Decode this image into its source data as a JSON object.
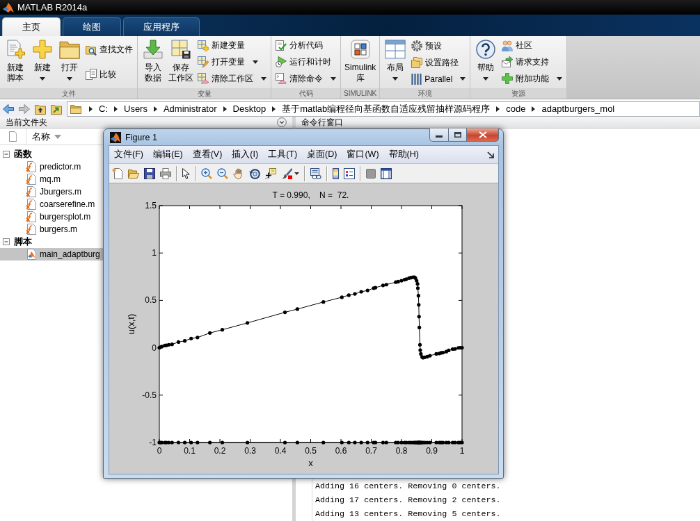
{
  "window": {
    "title": "MATLAB R2014a"
  },
  "toolstrip": {
    "tabs": [
      {
        "label": "主页",
        "selected": true
      },
      {
        "label": "绘图",
        "selected": false
      },
      {
        "label": "应用程序",
        "selected": false
      }
    ],
    "sections": [
      {
        "label": "文件",
        "items": [
          {
            "kind": "large",
            "label": "新建脚本",
            "dropdown": false
          },
          {
            "kind": "large",
            "label": "新建",
            "dropdown": true
          },
          {
            "kind": "large",
            "label": "打开",
            "dropdown": true
          },
          {
            "kind": "small",
            "label": "查找文件",
            "dropdown": false
          },
          {
            "kind": "small",
            "label": "比较",
            "dropdown": false
          }
        ]
      },
      {
        "label": "变量",
        "items": [
          {
            "kind": "large",
            "label": "导入数据",
            "dropdown": false
          },
          {
            "kind": "large",
            "label": "保存工作区",
            "dropdown": false
          },
          {
            "kind": "small",
            "label": "新建变量",
            "dropdown": false
          },
          {
            "kind": "small",
            "label": "打开变量",
            "dropdown": true
          },
          {
            "kind": "small",
            "label": "清除工作区",
            "dropdown": true
          }
        ]
      },
      {
        "label": "代码",
        "items": [
          {
            "kind": "small",
            "label": "分析代码",
            "dropdown": false
          },
          {
            "kind": "small",
            "label": "运行和计时",
            "dropdown": false
          },
          {
            "kind": "small",
            "label": "清除命令",
            "dropdown": true
          }
        ]
      },
      {
        "label": "SIMULINK",
        "items": [
          {
            "kind": "large",
            "label": "Simulink 库",
            "dropdown": false
          }
        ]
      },
      {
        "label": "环境",
        "items": [
          {
            "kind": "large",
            "label": "布局",
            "dropdown": true
          },
          {
            "kind": "small",
            "label": "预设",
            "dropdown": false
          },
          {
            "kind": "small",
            "label": "设置路径",
            "dropdown": false
          },
          {
            "kind": "small",
            "label": "Parallel",
            "dropdown": true
          }
        ]
      },
      {
        "label": "资源",
        "items": [
          {
            "kind": "large",
            "label": "帮助",
            "dropdown": true
          },
          {
            "kind": "small",
            "label": "社区",
            "dropdown": false
          },
          {
            "kind": "small",
            "label": "请求支持",
            "dropdown": false
          },
          {
            "kind": "small",
            "label": "附加功能",
            "dropdown": true
          }
        ]
      }
    ]
  },
  "address_bar": {
    "path": [
      "C:",
      "Users",
      "Administrator",
      "Desktop",
      "基于matlab编程径向基函数自适应残留抽样源码程序",
      "code",
      "adaptburgers_mol"
    ]
  },
  "current_folder": {
    "title": "当前文件夹",
    "column": "名称",
    "groups": [
      {
        "label": "函数",
        "expanded": true,
        "children": [
          {
            "name": "predictor.m",
            "kind": "function",
            "selected": false
          },
          {
            "name": "mq.m",
            "kind": "function",
            "selected": false
          },
          {
            "name": "Jburgers.m",
            "kind": "function",
            "selected": false
          },
          {
            "name": "coarserefine.m",
            "kind": "function",
            "selected": false
          },
          {
            "name": "burgersplot.m",
            "kind": "function",
            "selected": false
          },
          {
            "name": "burgers.m",
            "kind": "function",
            "selected": false
          }
        ]
      },
      {
        "label": "脚本",
        "expanded": true,
        "children": [
          {
            "name": "main_adaptburg",
            "kind": "script",
            "selected": true
          }
        ]
      }
    ]
  },
  "command_window": {
    "title": "命令行窗口",
    "lines": [
      "Adding 16 centers. Removing 0 centers.",
      "Adding 17 centers. Removing 2 centers.",
      "Adding 13 centers. Removing 5 centers."
    ]
  },
  "figure": {
    "title": "Figure 1",
    "menu": [
      "文件(F)",
      "编辑(E)",
      "查看(V)",
      "插入(I)",
      "工具(T)",
      "桌面(D)",
      "窗口(W)",
      "帮助(H)"
    ],
    "chart_data": {
      "type": "line",
      "title": "T = 0.990,    N =  72.",
      "xlabel": "x",
      "ylabel": "u(x,t)",
      "xlim": [
        0,
        1
      ],
      "ylim": [
        -1,
        1.5
      ],
      "xticks": [
        0,
        0.1,
        0.2,
        0.3,
        0.4,
        0.5,
        0.6,
        0.7,
        0.8,
        0.9,
        1
      ],
      "yticks": [
        -1,
        -0.5,
        0,
        0.5,
        1,
        1.5
      ],
      "x": [
        0,
        0.003,
        0.008,
        0.018,
        0.023,
        0.031,
        0.042,
        0.063,
        0.084,
        0.105,
        0.126,
        0.167,
        0.208,
        0.291,
        0.415,
        0.456,
        0.542,
        0.603,
        0.626,
        0.646,
        0.667,
        0.688,
        0.708,
        0.714,
        0.739,
        0.75,
        0.781,
        0.789,
        0.8,
        0.81,
        0.816,
        0.825,
        0.831,
        0.838,
        0.843,
        0.846,
        0.85,
        0.853,
        0.854,
        0.856,
        0.857,
        0.858,
        0.859,
        0.861,
        0.862,
        0.864,
        0.868,
        0.871,
        0.877,
        0.885,
        0.894,
        0.915,
        0.925,
        0.931,
        0.937,
        0.948,
        0.956,
        0.969,
        0.977,
        0.988,
        0.994,
        1
      ],
      "series": [
        {
          "color": "#000000",
          "values": [
            0,
            0.006,
            0.012,
            0.023,
            0.025,
            0.031,
            0.036,
            0.06,
            0.073,
            0.097,
            0.108,
            0.156,
            0.19,
            0.262,
            0.374,
            0.408,
            0.483,
            0.533,
            0.555,
            0.568,
            0.591,
            0.605,
            0.629,
            0.634,
            0.658,
            0.666,
            0.692,
            0.698,
            0.708,
            0.719,
            0.724,
            0.735,
            0.74,
            0.745,
            0.745,
            0.735,
            0.708,
            0.674,
            0.629,
            0.549,
            0.453,
            0.328,
            0.214,
            0.031,
            -0.025,
            -0.065,
            -0.097,
            -0.105,
            -0.1,
            -0.094,
            -0.084,
            -0.065,
            -0.06,
            -0.054,
            -0.052,
            -0.041,
            -0.028,
            -0.014,
            -0.012,
            -0.001,
            0,
            0
          ]
        },
        {
          "color": "#000000",
          "values": [
            -1,
            -1,
            -1,
            -1,
            -1,
            -1,
            -1,
            -1,
            -1,
            -1,
            -1,
            -1,
            -1,
            -1,
            -1,
            -1,
            -1,
            -1,
            -1,
            -1,
            -1,
            -1,
            -1,
            -1,
            -1,
            -1,
            -1,
            -1,
            -1,
            -1,
            -1,
            -1,
            -1,
            -1,
            -1,
            -1,
            -1,
            -1,
            -1,
            -1,
            -1,
            -1,
            -1,
            -1,
            -1,
            -1,
            -1,
            -1,
            -1,
            -1,
            -1,
            -1,
            -1,
            -1,
            -1,
            -1,
            -1,
            -1,
            -1,
            -1,
            -1,
            -1
          ]
        }
      ]
    }
  }
}
